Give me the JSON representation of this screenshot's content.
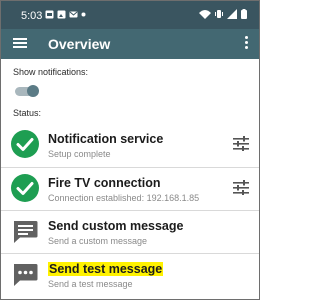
{
  "status_bar": {
    "time": "5:03"
  },
  "app_bar": {
    "title": "Overview"
  },
  "notifications_label": "Show notifications:",
  "notifications_enabled": true,
  "status_label": "Status:",
  "items": [
    {
      "title": "Notification service",
      "subtitle": "Setup complete",
      "icon": "check-circle-icon",
      "action_icon": "tune-icon"
    },
    {
      "title": "Fire TV connection",
      "subtitle": "Connection established: 192.168.1.85",
      "icon": "check-circle-icon",
      "action_icon": "tune-icon"
    },
    {
      "title": "Send custom message",
      "subtitle": "Send a custom message",
      "icon": "message-icon"
    },
    {
      "title": "Send test message",
      "subtitle": "Send a test message",
      "icon": "message-dots-icon",
      "highlighted": true
    }
  ],
  "colors": {
    "status_bar": "#3a5560",
    "app_bar": "#436872",
    "check_green": "#1e9e52",
    "highlight": "#fff200"
  }
}
